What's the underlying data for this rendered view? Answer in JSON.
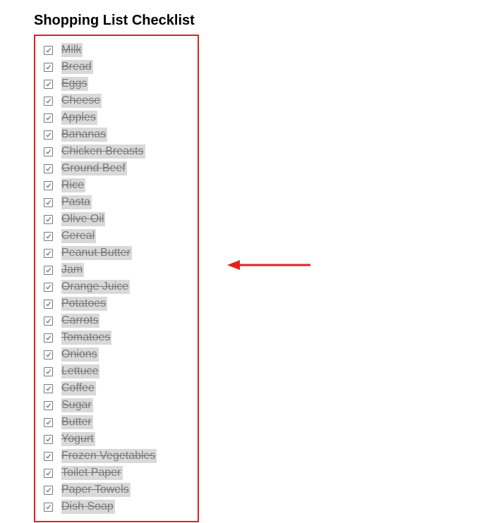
{
  "title": "Shopping List Checklist",
  "items": [
    {
      "label": "Milk",
      "checked": true
    },
    {
      "label": "Bread",
      "checked": true
    },
    {
      "label": "Eggs",
      "checked": true
    },
    {
      "label": "Cheese",
      "checked": true
    },
    {
      "label": "Apples",
      "checked": true
    },
    {
      "label": "Bananas",
      "checked": true
    },
    {
      "label": "Chicken Breasts",
      "checked": true
    },
    {
      "label": "Ground Beef",
      "checked": true
    },
    {
      "label": "Rice",
      "checked": true
    },
    {
      "label": "Pasta",
      "checked": true
    },
    {
      "label": "Olive Oil",
      "checked": true
    },
    {
      "label": "Cereal",
      "checked": true
    },
    {
      "label": "Peanut Butter",
      "checked": true
    },
    {
      "label": "Jam",
      "checked": true
    },
    {
      "label": "Orange Juice",
      "checked": true
    },
    {
      "label": "Potatoes",
      "checked": true
    },
    {
      "label": "Carrots",
      "checked": true
    },
    {
      "label": "Tomatoes",
      "checked": true
    },
    {
      "label": "Onions",
      "checked": true
    },
    {
      "label": "Lettuce",
      "checked": true
    },
    {
      "label": "Coffee",
      "checked": true
    },
    {
      "label": "Sugar",
      "checked": true
    },
    {
      "label": "Butter",
      "checked": true
    },
    {
      "label": "Yogurt",
      "checked": true
    },
    {
      "label": "Frozen Vegetables",
      "checked": true
    },
    {
      "label": "Toilet Paper",
      "checked": true
    },
    {
      "label": "Paper Towels",
      "checked": true
    },
    {
      "label": "Dish Soap",
      "checked": true
    }
  ],
  "colors": {
    "highlight": "#e1221f",
    "muted": "#7a7a7a",
    "strike_bg": "#d9d9d9"
  }
}
